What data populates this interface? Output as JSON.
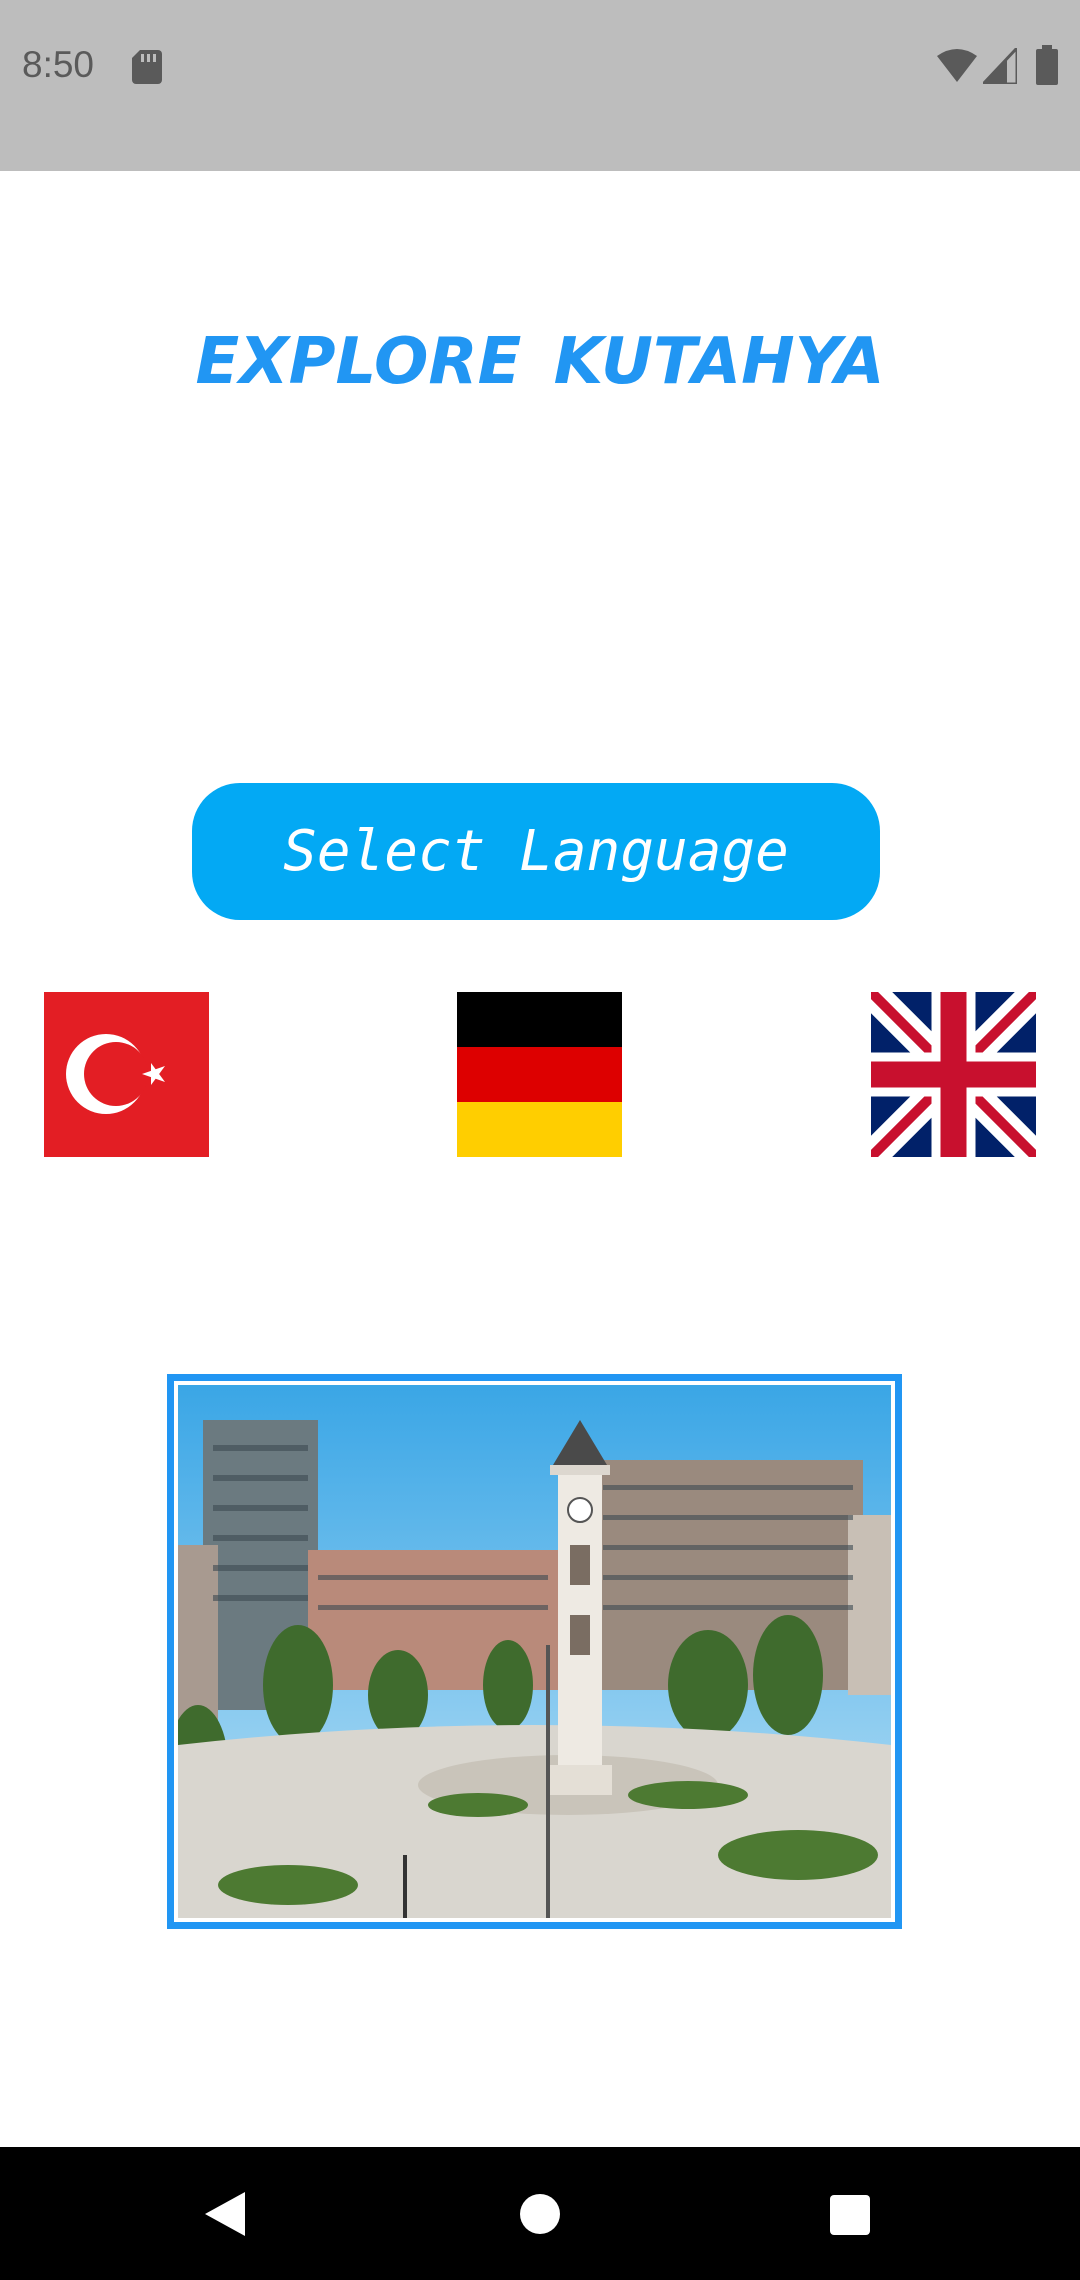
{
  "status_bar": {
    "time": "8:50",
    "icons": [
      "sd-card-icon",
      "wifi-icon",
      "signal-icon",
      "battery-icon"
    ]
  },
  "app": {
    "title": "EXPLORE KUTAHYA",
    "title_color": "#2196f3",
    "select_language_label": "Select Language",
    "button_color": "#03a9f4"
  },
  "languages": [
    {
      "name": "turkish-flag-icon",
      "flag_colors": [
        "#e31e24",
        "#ffffff"
      ]
    },
    {
      "name": "german-flag-icon",
      "flag_colors": [
        "#000000",
        "#dd0000",
        "#ffce00"
      ]
    },
    {
      "name": "uk-flag-icon",
      "flag_colors": [
        "#012169",
        "#ffffff",
        "#c8102e"
      ]
    }
  ],
  "photo": {
    "subject": "kutahya-clock-tower-square-photo",
    "frame_color": "#2196f3"
  },
  "nav_bar": {
    "buttons": [
      "back-icon",
      "home-icon",
      "recents-icon"
    ]
  }
}
